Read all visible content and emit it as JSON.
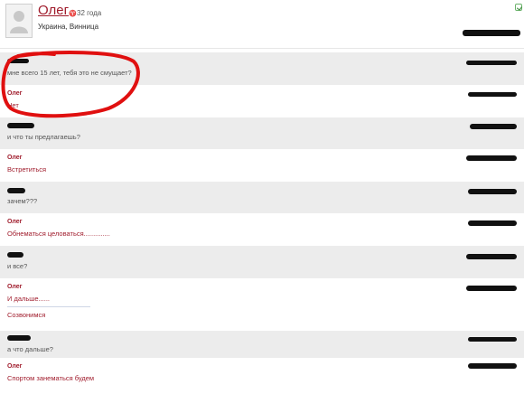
{
  "profile": {
    "name": "Олег",
    "age": "32 года",
    "location": "Украина, Винница"
  },
  "messages": [
    {
      "author": "",
      "text": "мне всего 15 лет, тебя это не смущает?"
    },
    {
      "author": "Олег",
      "text": "Нет"
    },
    {
      "author": "",
      "text": "и что ты предлагаешь?"
    },
    {
      "author": "Олег",
      "text": "Встретиться"
    },
    {
      "author": "",
      "text": "зачем???"
    },
    {
      "author": "Олег",
      "text": "Обнематься целоваться.............."
    },
    {
      "author": "",
      "text": "и все?"
    },
    {
      "author": "Олег",
      "text": "И дальше......",
      "text2": "Созвонимся"
    },
    {
      "author": "",
      "text": "а что дальше?"
    },
    {
      "author": "Олег",
      "text": "Спортом занематься будем"
    }
  ],
  "colors": {
    "accent": "#a01c2c",
    "row_grey": "#ececec",
    "highlight_circle": "#e01010"
  },
  "icons": [
    "default-avatar-icon",
    "zodiac-sign-icon",
    "online-status-icon"
  ]
}
